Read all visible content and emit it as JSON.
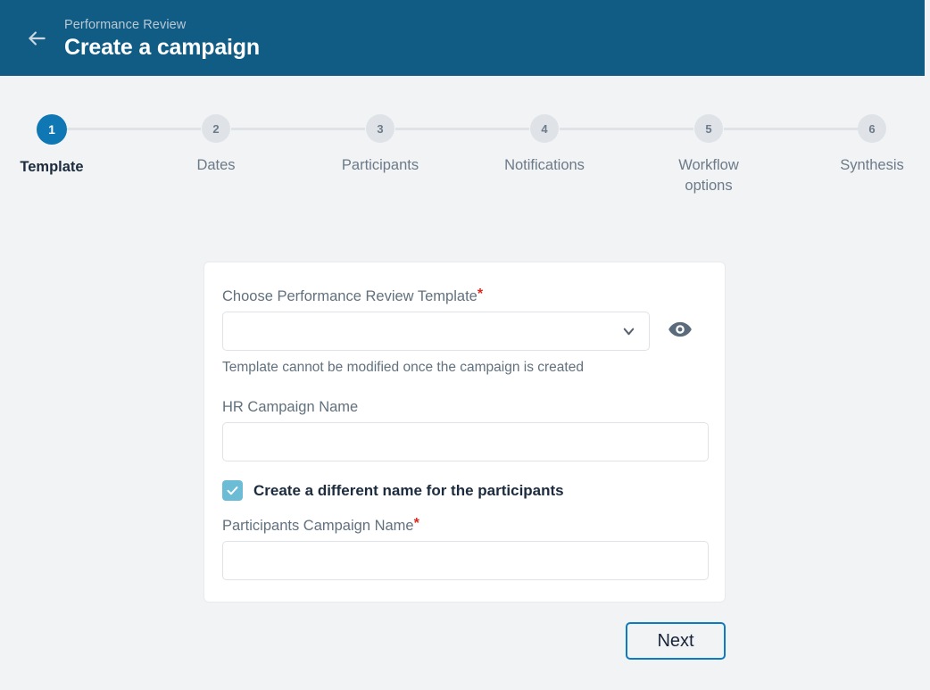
{
  "header": {
    "back_icon": "arrow-left-icon",
    "eyebrow": "Performance Review",
    "title": "Create a campaign",
    "background_color": "#105c85"
  },
  "stepper": {
    "active_index": 0,
    "active_color": "#1077b5",
    "inactive_color": "#dfe3e8",
    "steps": [
      {
        "number": "1",
        "label": "Template"
      },
      {
        "number": "2",
        "label": "Dates"
      },
      {
        "number": "3",
        "label": "Participants"
      },
      {
        "number": "4",
        "label": "Notifications"
      },
      {
        "number": "5",
        "label": "Workflow options"
      },
      {
        "number": "6",
        "label": "Synthesis"
      }
    ]
  },
  "form": {
    "template": {
      "label": "Choose Performance Review Template",
      "required_marker": "*",
      "selected_value": "",
      "placeholder": "",
      "chevron_icon": "chevron-down-icon",
      "preview_icon": "eye-icon",
      "help_text": "Template cannot be modified once the campaign is created"
    },
    "hr_campaign_name": {
      "label": "HR Campaign Name",
      "value": "",
      "placeholder": ""
    },
    "different_name_checkbox": {
      "label": "Create a different name for the participants",
      "checked": true,
      "checked_color": "#6bbcd4"
    },
    "participants_campaign_name": {
      "label": "Participants Campaign Name",
      "required_marker": "*",
      "value": "",
      "placeholder": ""
    }
  },
  "footer": {
    "next_label": "Next",
    "next_border_color": "#0b7cc1"
  }
}
